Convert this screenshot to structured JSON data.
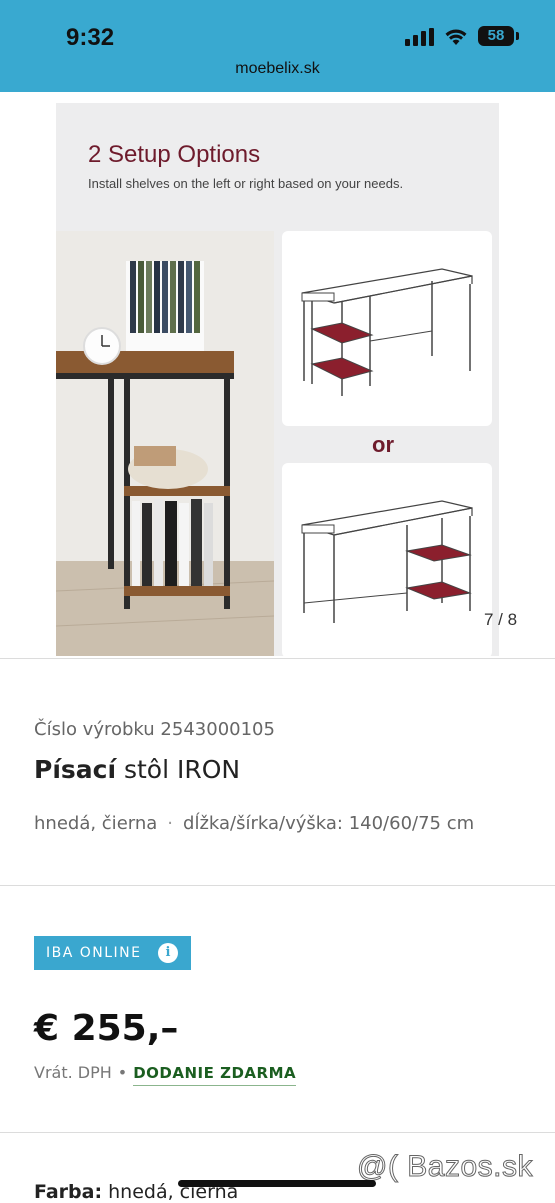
{
  "status_bar": {
    "time": "9:32",
    "battery": "58"
  },
  "browser": {
    "url": "moebelix.sk"
  },
  "gallery": {
    "image_title": "2 Setup Options",
    "image_subtitle": "Install shelves on the left or right based on your needs.",
    "image_or": "or",
    "counter": "7 / 8",
    "accent_color": "#7a1a2e"
  },
  "product": {
    "sku": "Číslo výrobku 2543000105",
    "name_bold": "Písací",
    "name_rest": " stôl IRON",
    "color_text": "hnedá, čierna",
    "dimensions": "dĺžka/šírka/výška: 140/60/75 cm",
    "attrs_separator": "·"
  },
  "pricing": {
    "badge": "IBA ONLINE",
    "badge_icon": "info-icon",
    "price": "€ 255,–",
    "vat": "Vrát. DPH",
    "vat_separator": "•",
    "delivery": "DODANIE ZDARMA"
  },
  "color_section": {
    "label": "Farba:",
    "value": " hnedá, čierna"
  },
  "watermark": "@( Bazos.sk",
  "colors": {
    "topbar": "#39a9d0",
    "badge": "#3aa7cf",
    "delivery": "#1b5e20"
  }
}
